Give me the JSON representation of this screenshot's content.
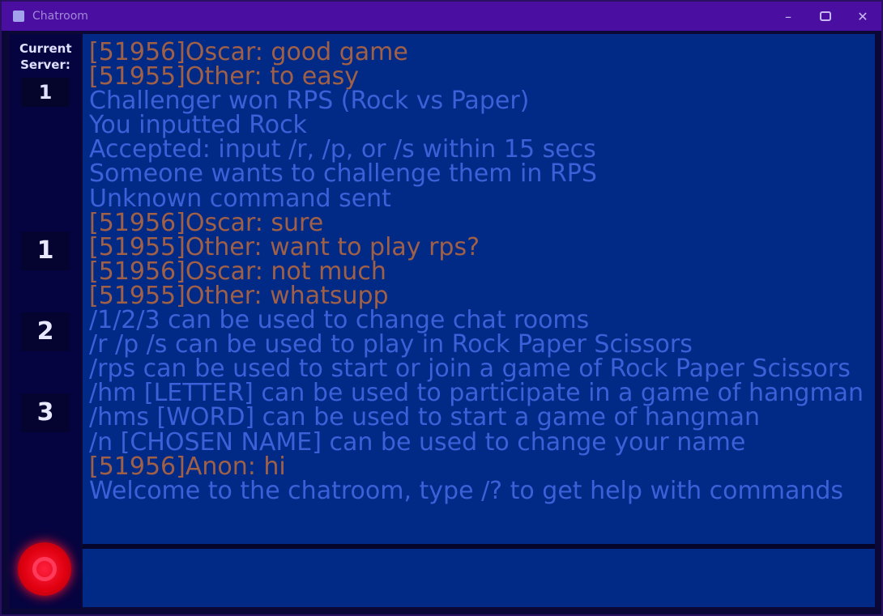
{
  "window": {
    "title": "Chatroom",
    "controls": {
      "minimize": "–",
      "close": "✕"
    },
    "app_icon": "app-icon"
  },
  "sidebar": {
    "current_label": "Current Server:",
    "current_value": "1",
    "rooms": [
      "1",
      "2",
      "3"
    ],
    "power_icon": "power-icon",
    "colors": {
      "power": "#ff1030"
    }
  },
  "chat": {
    "colors": {
      "system": "#3c60d8",
      "user": "#a06048",
      "background": "#002a86"
    },
    "lines": [
      {
        "kind": "user",
        "text": "[51956]Oscar: good game"
      },
      {
        "kind": "user",
        "text": "[51955]Other: to easy"
      },
      {
        "kind": "system",
        "text": "Challenger won RPS (Rock vs Paper)"
      },
      {
        "kind": "system",
        "text": "You inputted Rock"
      },
      {
        "kind": "system",
        "text": "Accepted: input /r, /p, or /s within 15 secs"
      },
      {
        "kind": "system",
        "text": "Someone wants to challenge them in RPS"
      },
      {
        "kind": "system",
        "text": "Unknown command sent"
      },
      {
        "kind": "user",
        "text": "[51956]Oscar: sure"
      },
      {
        "kind": "user",
        "text": "[51955]Other: want to play rps?"
      },
      {
        "kind": "user",
        "text": "[51956]Oscar: not much"
      },
      {
        "kind": "user",
        "text": "[51955]Other: whatsupp"
      },
      {
        "kind": "system",
        "text": "/1/2/3 can be used to change chat rooms"
      },
      {
        "kind": "system",
        "text": "/r /p /s can be used to play in Rock Paper Scissors"
      },
      {
        "kind": "system",
        "text": "/rps can be used to start or join a game of Rock Paper Scissors"
      },
      {
        "kind": "system",
        "text": "/hm [LETTER] can be used to participate in a game of hangman"
      },
      {
        "kind": "system",
        "text": "/hms [WORD] can be used to start a game of hangman"
      },
      {
        "kind": "system",
        "text": "/n [CHOSEN NAME] can be used to change your name"
      },
      {
        "kind": "user",
        "text": "[51956]Anon: hi"
      },
      {
        "kind": "system",
        "text": "Welcome to the chatroom, type /? to get help with commands"
      }
    ]
  },
  "input": {
    "value": "",
    "placeholder": ""
  }
}
